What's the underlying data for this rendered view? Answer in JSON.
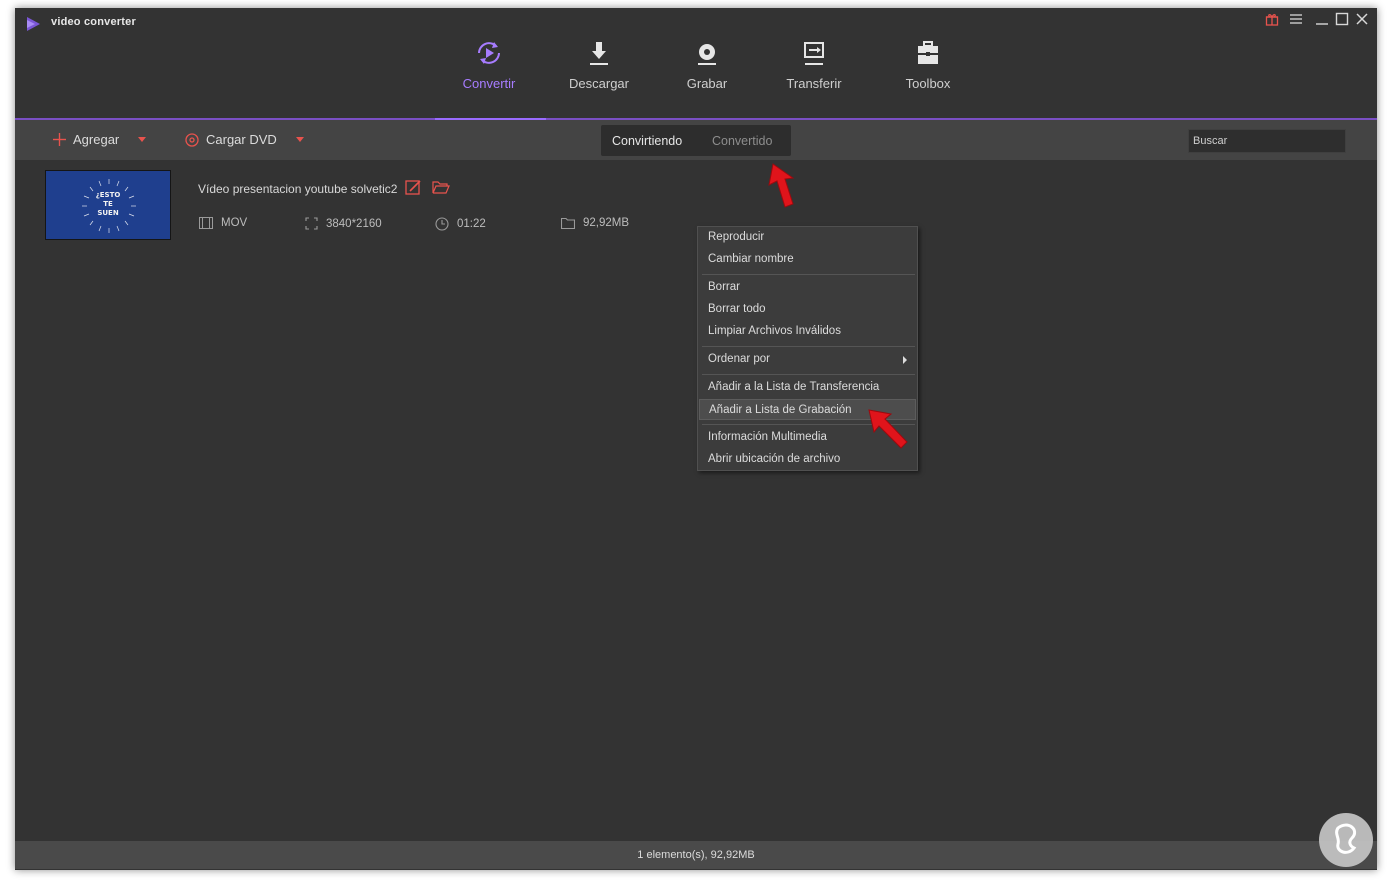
{
  "app": {
    "title": "video converter"
  },
  "nav": {
    "tabs": [
      {
        "label": "Convertir",
        "icon": "convert-icon",
        "active": true
      },
      {
        "label": "Descargar",
        "icon": "download-icon",
        "active": false
      },
      {
        "label": "Grabar",
        "icon": "disc-icon",
        "active": false
      },
      {
        "label": "Transferir",
        "icon": "transfer-icon",
        "active": false
      },
      {
        "label": "Toolbox",
        "icon": "toolbox-icon",
        "active": false
      }
    ]
  },
  "toolbar": {
    "add_label": "Agregar",
    "dvd_label": "Cargar DVD",
    "segments": [
      "Convirtiendo",
      "Convertido"
    ],
    "search_placeholder": "Buscar"
  },
  "file": {
    "name": "Vídeo presentacion youtube solvetic2",
    "thumbnail_text": [
      "¿ESTO",
      "TE",
      "SUEN"
    ],
    "format": "MOV",
    "resolution": "3840*2160",
    "duration": "01:22",
    "size": "92,92MB"
  },
  "context_menu": {
    "items": [
      "Reproducir",
      "Cambiar nombre",
      "Borrar",
      "Borrar todo",
      "Limpiar Archivos Inválidos",
      "Ordenar por",
      "Añadir a la Lista de Transferencia",
      "Añadir a Lista de Grabación",
      "Información Multimedia",
      "Abrir ubicación de archivo"
    ],
    "highlighted": "Añadir a Lista de Grabación"
  },
  "status": {
    "text": "1 elemento(s), 92,92MB"
  },
  "colors": {
    "accent": "#a77cff",
    "red": "#e8534d",
    "background": "#333333",
    "annotation_arrow": "#e0141b"
  }
}
